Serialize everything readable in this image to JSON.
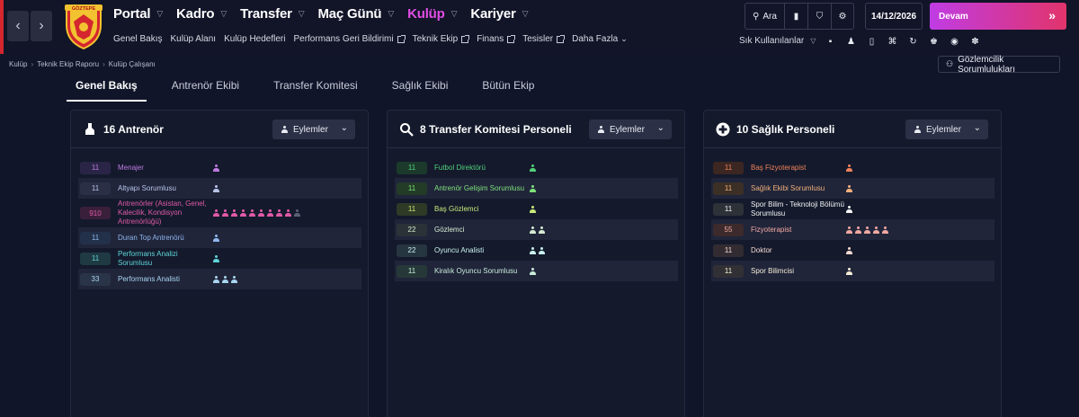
{
  "nav": {
    "back_icon": "chevron-left-icon",
    "forward_icon": "chevron-right-icon",
    "club_logo_text": "GÖZTEPE",
    "main_items": [
      {
        "label": "Portal",
        "active": false
      },
      {
        "label": "Kadro",
        "active": false
      },
      {
        "label": "Transfer",
        "active": false
      },
      {
        "label": "Maç Günü",
        "active": false
      },
      {
        "label": "Kulüp",
        "active": true
      },
      {
        "label": "Kariyer",
        "active": false
      }
    ],
    "sub_items": [
      {
        "label": "Genel Bakış",
        "external": false
      },
      {
        "label": "Kulüp Alanı",
        "external": false
      },
      {
        "label": "Kulüp Hedefleri",
        "external": false
      },
      {
        "label": "Performans Geri Bildirimi",
        "external": true
      },
      {
        "label": "Teknik Ekip",
        "external": true
      },
      {
        "label": "Finans",
        "external": true
      },
      {
        "label": "Tesisler",
        "external": true
      },
      {
        "label": "Daha Fazla",
        "external": false
      }
    ]
  },
  "toolbar": {
    "search_label": "Ara",
    "date": "14/12/2026",
    "continue_label": "Devam",
    "shortcuts_label": "Sık Kullanılanlar"
  },
  "breadcrumb": [
    "Kulüp",
    "Teknik Ekip Raporu",
    "Kulüp Çalışanı"
  ],
  "responsibilities_button": "Gözlemcilik Sorumlulukları",
  "tabs": [
    {
      "label": "Genel Bakış",
      "active": true
    },
    {
      "label": "Antrenör Ekibi",
      "active": false
    },
    {
      "label": "Transfer Komitesi",
      "active": false
    },
    {
      "label": "Sağlık Ekibi",
      "active": false
    },
    {
      "label": "Bütün Ekip",
      "active": false
    }
  ],
  "actions_label": "Eylemler",
  "panels": [
    {
      "title": "16 Antrenör",
      "icon": "whistle-icon",
      "rows": [
        {
          "num": "11",
          "role": "Menajer",
          "color": "#c07ae0",
          "num_bg": "#2a2547",
          "people": 1,
          "dim": 0
        },
        {
          "num": "11",
          "role": "Altyapı Sorumlusu",
          "color": "#b9c3e8",
          "num_bg": "#2a2f46",
          "people": 1,
          "dim": 0
        },
        {
          "num": "910",
          "role": "Antrenörler (Asistan, Genel, Kalecilik, Kondisyon Antrenörlüğü)",
          "color": "#e05aa8",
          "num_bg": "#3a1f3a",
          "people": 9,
          "dim": 1
        },
        {
          "num": "11",
          "role": "Duran Top Antrenörü",
          "color": "#8fb6ee",
          "num_bg": "#233049",
          "people": 1,
          "dim": 0
        },
        {
          "num": "11",
          "role": "Performans Analizi Sorumlusu",
          "color": "#5fd4d8",
          "num_bg": "#1f3a42",
          "people": 1,
          "dim": 0
        },
        {
          "num": "33",
          "role": "Performans Analisti",
          "color": "#a9d6ef",
          "num_bg": "#2a3448",
          "people": 3,
          "dim": 0
        }
      ]
    },
    {
      "title": "8 Transfer Komitesi Personeli",
      "icon": "magnifier-icon",
      "rows": [
        {
          "num": "11",
          "role": "Futbol Direktörü",
          "color": "#52d07a",
          "num_bg": "#1c3a2c",
          "people": 1,
          "dim": 0
        },
        {
          "num": "11",
          "role": "Antrenör Gelişim Sorumlusu",
          "color": "#7ee07a",
          "num_bg": "#233c28",
          "people": 1,
          "dim": 0
        },
        {
          "num": "11",
          "role": "Baş Gözlemci",
          "color": "#c8e87a",
          "num_bg": "#2f3a26",
          "people": 1,
          "dim": 0
        },
        {
          "num": "22",
          "role": "Gözlemci",
          "color": "#d6ecd2",
          "num_bg": "#2c3338",
          "people": 2,
          "dim": 0
        },
        {
          "num": "22",
          "role": "Oyuncu Analisti",
          "color": "#c8f0ec",
          "num_bg": "#263640",
          "people": 2,
          "dim": 0
        },
        {
          "num": "11",
          "role": "Kiralık Oyuncu Sorumlusu",
          "color": "#c8ecd8",
          "num_bg": "#263938",
          "people": 1,
          "dim": 0
        }
      ]
    },
    {
      "title": "10 Sağlık Personeli",
      "icon": "medical-cross-icon",
      "rows": [
        {
          "num": "11",
          "role": "Baş Fizyoterapist",
          "color": "#f0825a",
          "num_bg": "#3c2622",
          "people": 1,
          "dim": 0
        },
        {
          "num": "11",
          "role": "Sağlık Ekibi Sorumlusu",
          "color": "#f3b07a",
          "num_bg": "#3c2f26",
          "people": 1,
          "dim": 0
        },
        {
          "num": "11",
          "role": "Spor Bilim - Teknoloji Bölümü Sorumlusu",
          "color": "#f3f3f3",
          "num_bg": "#2d3138",
          "people": 1,
          "dim": 0
        },
        {
          "num": "55",
          "role": "Fizyoterapist",
          "color": "#f0a8a0",
          "num_bg": "#3c2a2c",
          "people": 5,
          "dim": 0
        },
        {
          "num": "11",
          "role": "Doktor",
          "color": "#f5d8d0",
          "num_bg": "#322c32",
          "people": 1,
          "dim": 0
        },
        {
          "num": "11",
          "role": "Spor Bilimcisi",
          "color": "#f7eed8",
          "num_bg": "#313034",
          "people": 1,
          "dim": 0
        }
      ]
    }
  ],
  "colors": {
    "accent": "#e24de6",
    "background": "#11152a",
    "continue_gradient_start": "#c03ce4",
    "continue_gradient_end": "#e1346b"
  }
}
